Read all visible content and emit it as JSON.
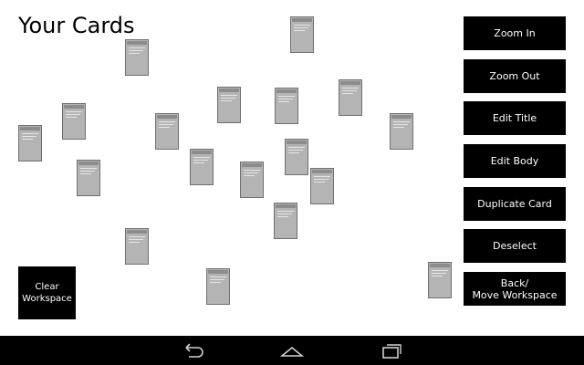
{
  "title": "Your Cards",
  "buttons": {
    "zoom_in": "Zoom In",
    "zoom_out": "Zoom Out",
    "edit_title": "Edit Title",
    "edit_body": "Edit Body",
    "duplicate_card": "Duplicate Card",
    "deselect": "Deselect",
    "back_move_workspace": "Back/\nMove Workspace",
    "clear_workspace": "Clear\nWorkspace"
  },
  "nav": {
    "icons": [
      "back-icon",
      "home-icon",
      "recent-apps-icon"
    ]
  },
  "colors": {
    "button_bg": "#000000",
    "card_fill": "#b4b4b4",
    "card_border": "#6f6f6f"
  }
}
